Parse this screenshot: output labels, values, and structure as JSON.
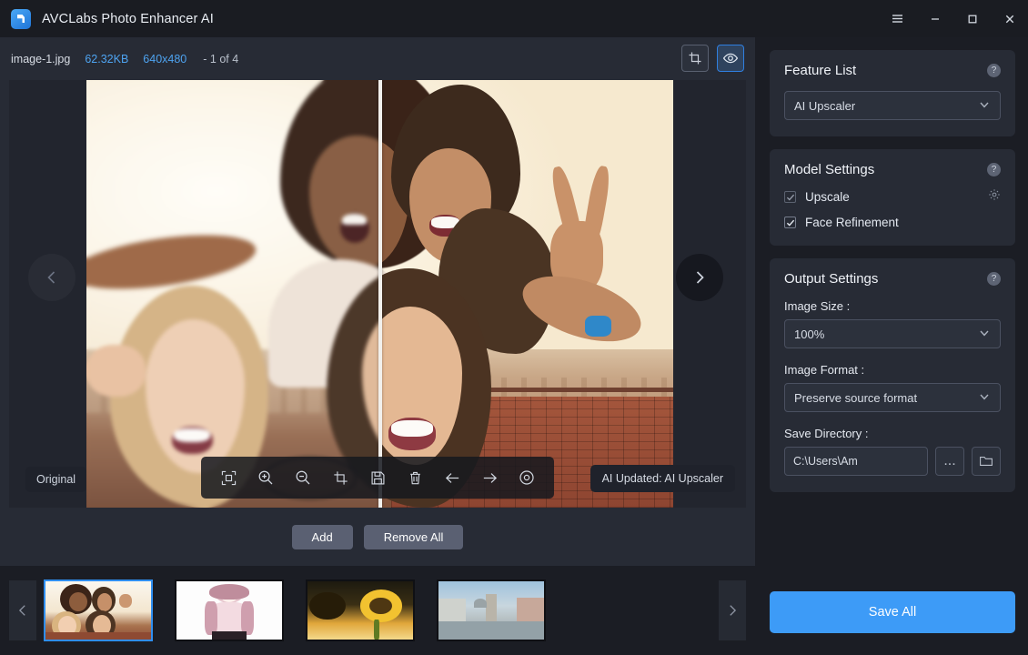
{
  "app": {
    "title": "AVCLabs Photo Enhancer AI",
    "logo_icon": "avclabs-logo-icon",
    "accent_color": "#3d9bf7",
    "link_color": "#4ea3f0"
  },
  "window_controls": {
    "menu": "menu-icon",
    "minimize": "minimize-icon",
    "maximize": "maximize-icon",
    "close": "close-icon"
  },
  "file_info": {
    "filename": "image-1.jpg",
    "filesize": "62.32KB",
    "dimensions": "640x480",
    "position": "- 1 of 4"
  },
  "view_tools": [
    {
      "name": "crop-tool-button",
      "icon": "crop-icon",
      "active": false
    },
    {
      "name": "preview-toggle-button",
      "icon": "eye-icon",
      "active": true
    }
  ],
  "preview": {
    "original_label": "Original",
    "updated_label": "AI Updated: AI Upscaler",
    "prev_arrow": "chevron-left-icon",
    "next_arrow": "chevron-right-icon",
    "split_position": "50%"
  },
  "image_toolbar": [
    {
      "name": "fit-to-screen-button",
      "icon": "fit-screen-icon"
    },
    {
      "name": "zoom-in-button",
      "icon": "zoom-in-icon"
    },
    {
      "name": "zoom-out-button",
      "icon": "zoom-out-icon"
    },
    {
      "name": "crop-button",
      "icon": "crop-icon"
    },
    {
      "name": "save-button",
      "icon": "save-disk-icon"
    },
    {
      "name": "delete-button",
      "icon": "trash-icon"
    },
    {
      "name": "undo-button",
      "icon": "arrow-left-icon"
    },
    {
      "name": "redo-button",
      "icon": "arrow-right-icon"
    },
    {
      "name": "compare-button",
      "icon": "eye-circle-icon"
    }
  ],
  "list_actions": {
    "add_label": "Add",
    "remove_all_label": "Remove All"
  },
  "thumbnails": {
    "prev_arrow": "chevron-left-icon",
    "next_arrow": "chevron-right-icon",
    "items": [
      {
        "name": "thumbnail-1",
        "alt": "group selfie of four smiling women",
        "selected": true
      },
      {
        "name": "thumbnail-2",
        "alt": "anime girl illustration on white",
        "selected": false
      },
      {
        "name": "thumbnail-3",
        "alt": "sunflower at golden sunset",
        "selected": false
      },
      {
        "name": "thumbnail-4",
        "alt": "venice canal cityscape",
        "selected": false
      }
    ]
  },
  "feature_list": {
    "title": "Feature List",
    "help_icon": "help-icon",
    "selected": "AI Upscaler"
  },
  "model_settings": {
    "title": "Model Settings",
    "help_icon": "help-icon",
    "options": [
      {
        "name": "upscale-checkbox",
        "label": "Upscale",
        "checked": true,
        "dim": true,
        "gear_icon": "gear-icon"
      },
      {
        "name": "face-refinement-checkbox",
        "label": "Face Refinement",
        "checked": true,
        "dim": false,
        "gear_icon": null
      }
    ]
  },
  "output_settings": {
    "title": "Output Settings",
    "help_icon": "help-icon",
    "image_size_label": "Image Size :",
    "image_size_value": "100%",
    "image_format_label": "Image Format :",
    "image_format_value": "Preserve source format",
    "save_directory_label": "Save Directory :",
    "save_directory_value": "C:\\Users\\Am",
    "browse_label": "...",
    "folder_icon": "folder-open-icon"
  },
  "save_all": {
    "label": "Save All"
  }
}
